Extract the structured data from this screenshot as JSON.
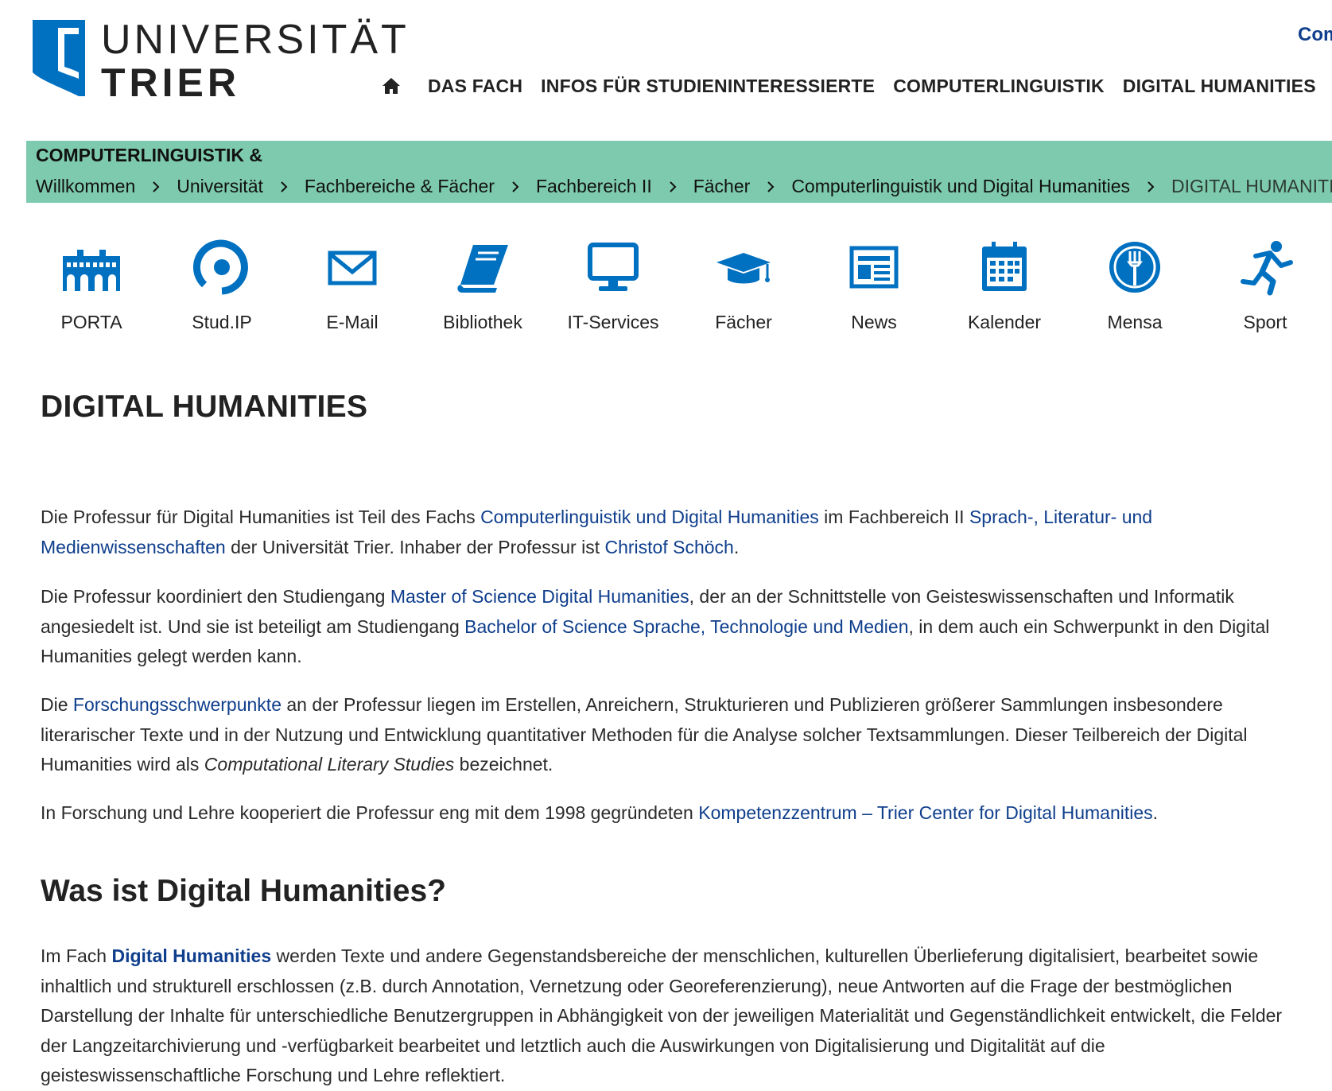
{
  "header": {
    "logo_line1": "UNIVERSITÄT",
    "logo_line2": "TRIER",
    "service_link": "Com",
    "nav": [
      {
        "label": "DAS FACH"
      },
      {
        "label": "INFOS FÜR STUDIENINTERESSIERTE"
      },
      {
        "label": "COMPUTERLINGUISTIK"
      },
      {
        "label": "DIGITAL HUMANITIES"
      }
    ]
  },
  "band": {
    "title": "COMPUTERLINGUISTIK &",
    "breadcrumb": [
      "Willkommen",
      "Universität",
      "Fachbereiche & Fächer",
      "Fachbereich II",
      "Fächer",
      "Computerlinguistik und Digital Humanities",
      "DIGITAL HUMANITIES"
    ]
  },
  "quicklinks": [
    {
      "label": "PORTA",
      "icon": "porta-gate-icon"
    },
    {
      "label": "Stud.IP",
      "icon": "studip-icon"
    },
    {
      "label": "E-Mail",
      "icon": "envelope-icon"
    },
    {
      "label": "Bibliothek",
      "icon": "book-icon"
    },
    {
      "label": "IT-Services",
      "icon": "monitor-icon"
    },
    {
      "label": "Fächer",
      "icon": "graduation-cap-icon"
    },
    {
      "label": "News",
      "icon": "newspaper-icon"
    },
    {
      "label": "Kalender",
      "icon": "calendar-icon"
    },
    {
      "label": "Mensa",
      "icon": "cutlery-icon"
    },
    {
      "label": "Sport",
      "icon": "runner-icon"
    }
  ],
  "content": {
    "title": "DIGITAL HUMANITIES",
    "p1": {
      "t1": "Die Professur für Digital Humanities ist Teil des Fachs ",
      "l1": "Computerlinguistik und Digital Humanities",
      "t2": " im Fachbereich II ",
      "l2": "Sprach-, Literatur- und Medienwissenschaften",
      "t3": " der Universität Trier. Inhaber der Professur ist ",
      "l3": "Christof Schöch",
      "t4": "."
    },
    "p2": {
      "t1": "Die Professur koordiniert den Studiengang ",
      "l1": "Master of Science Digital Humanities",
      "t2": ", der an der Schnittstelle von Geisteswissenschaften und Informatik angesiedelt ist. Und sie ist beteiligt am Studiengang ",
      "l2": "Bachelor of Science Sprache, Technologie und Medien",
      "t3": ", in dem auch ein Schwerpunkt in den Digital Humanities gelegt werden kann."
    },
    "p3": {
      "t1": "Die ",
      "l1": "Forschungsschwerpunkte",
      "t2": " an der Professur liegen im Erstellen, Anreichern, Strukturieren und Publizieren größerer Sammlungen insbesondere literarischer Texte und in der Nutzung und Entwicklung quantitativer Methoden für die Analyse solcher Textsammlungen. Dieser Teilbereich der Digital Humanities wird als ",
      "em": "Computational Literary Studies",
      "t3": " bezeichnet."
    },
    "p4": {
      "t1": "In Forschung und Lehre kooperiert die Professur eng mit dem 1998 gegründeten ",
      "l1": "Kompetenzzentrum – Trier Center for Digital Humanities",
      "t2": "."
    },
    "subtitle": "Was ist Digital Humanities?",
    "p5": {
      "t1": "Im Fach ",
      "l1": "Digital Humanities",
      "t2": " werden Texte und andere Gegenstandsbereiche der menschlichen, kulturellen Überlieferung digitalisiert, bearbeitet sowie inhaltlich und strukturell erschlossen (z.B. durch Annotation, Vernetzung oder Georeferenzierung), neue Antworten auf die Frage der bestmöglichen Darstellung der Inhalte für unterschiedliche Benutzergruppen in Abhängigkeit von der jeweiligen Materialität und Gegenständlichkeit entwickelt, die Felder der Langzeitarchivierung und -verfügbarkeit bearbeitet und letztlich auch die Auswirkungen von Digitalisierung und Digitalität auf die geisteswissenschaftliche Forschung und Lehre reflektiert."
    }
  },
  "colors": {
    "brand_blue": "#0070c0",
    "link_blue": "#0f3e8c",
    "band_green": "#7dcaae"
  }
}
